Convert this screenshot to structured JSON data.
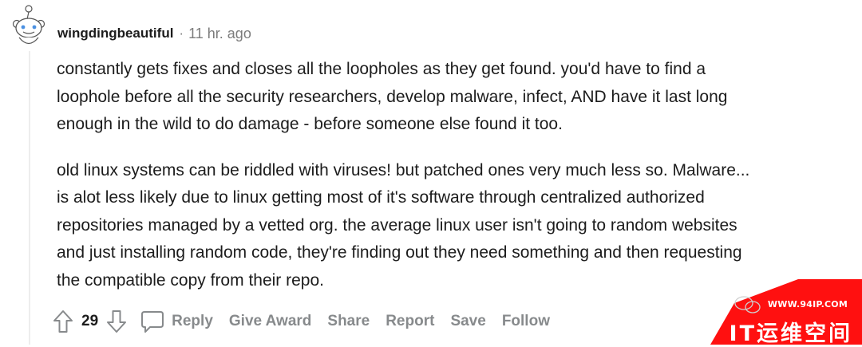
{
  "comment": {
    "username": "wingdingbeautiful",
    "separator": "·",
    "time": "11 hr. ago",
    "paragraphs": {
      "p1": [
        "constantly gets fixes and closes all the loopholes as they get found. you'd have to find a",
        "loophole before all the security researchers, develop malware, infect, AND have it last long",
        "enough in the wild to do damage - before someone else found it too."
      ],
      "p2": [
        "old linux systems can be riddled with viruses! but patched ones very much less so. Malware...",
        "is alot less likely due to linux getting most of it's software through centralized authorized",
        "repositories managed by a vetted org. the average linux user isn't going to random websites",
        "and just installing random code, they're finding out they need something and then requesting",
        "the compatible copy from their repo."
      ]
    }
  },
  "actions": {
    "upvote_icon": "arrow-up-icon",
    "score": "29",
    "downvote_icon": "arrow-down-icon",
    "reply_icon": "chat-bubble-icon",
    "reply": "Reply",
    "give_award": "Give Award",
    "share": "Share",
    "report": "Report",
    "save": "Save",
    "follow": "Follow"
  },
  "watermark": {
    "url": "WWW.94IP.COM",
    "brand": "IT运维空间",
    "color": "#ff1010"
  },
  "colors": {
    "text": "#1c1c1c",
    "meta": "#7c7c7c",
    "action": "#878a8c",
    "thread_line": "#ededed"
  }
}
